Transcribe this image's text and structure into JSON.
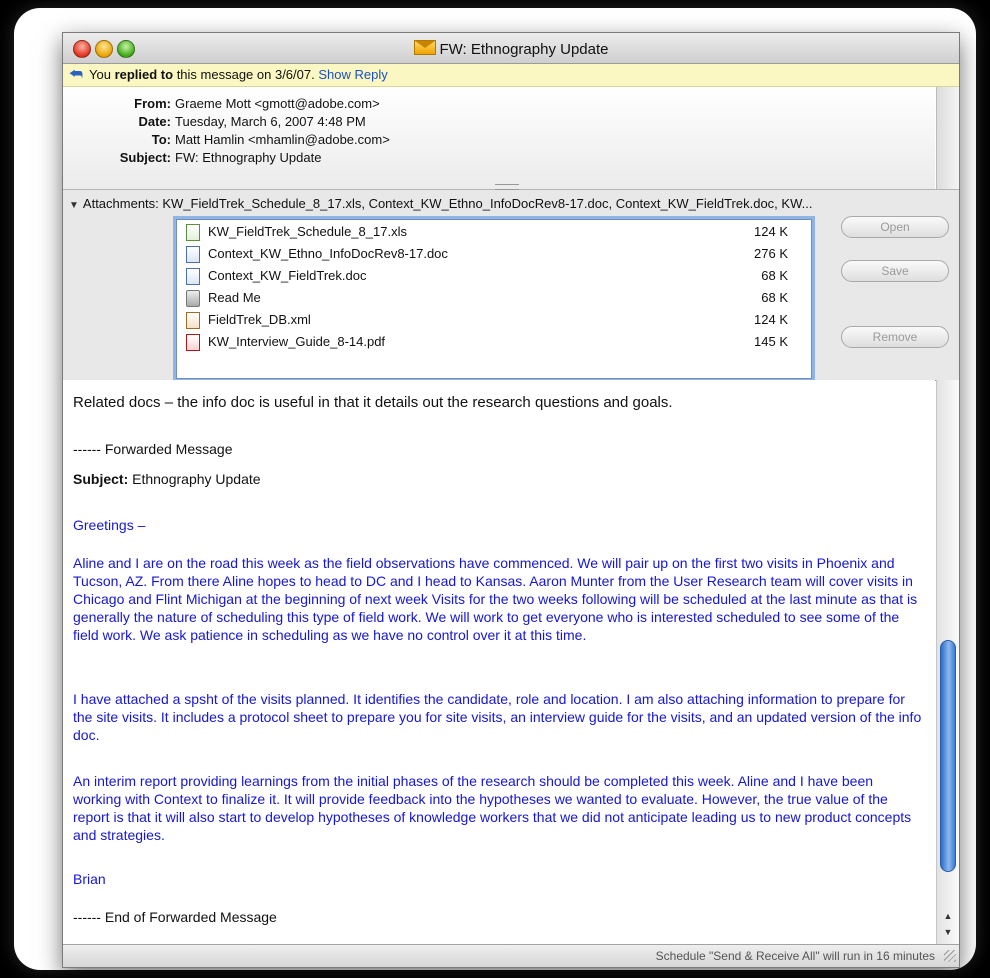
{
  "window": {
    "title": "FW: Ethnography Update"
  },
  "reply_bar": {
    "prefix": "You ",
    "bold": "replied to",
    "suffix": " this message on 3/6/07.",
    "link": "Show Reply"
  },
  "headers": [
    {
      "label": "From:",
      "value": "Graeme Mott <gmott@adobe.com>"
    },
    {
      "label": "Date:",
      "value": "Tuesday, March 6, 2007 4:48 PM"
    },
    {
      "label": "To:",
      "value": "Matt Hamlin <mhamlin@adobe.com>"
    },
    {
      "label": "Subject:",
      "value": "FW: Ethnography Update"
    }
  ],
  "attachments": {
    "summary": "Attachments:  KW_FieldTrek_Schedule_8_17.xls, Context_KW_Ethno_InfoDocRev8-17.doc, Context_KW_FieldTrek.doc, KW...",
    "files": [
      {
        "name": "KW_FieldTrek_Schedule_8_17.xls",
        "size": "124 K",
        "icon": "xls-file-icon"
      },
      {
        "name": "Context_KW_Ethno_InfoDocRev8-17.doc",
        "size": "276 K",
        "icon": "word-doc-icon"
      },
      {
        "name": "Context_KW_FieldTrek.doc",
        "size": "68 K",
        "icon": "word-doc-icon"
      },
      {
        "name": "Read Me",
        "size": "68 K",
        "icon": "readme-icon"
      },
      {
        "name": "FieldTrek_DB.xml",
        "size": "124 K",
        "icon": "xml-file-icon"
      },
      {
        "name": "KW_Interview_Guide_8-14.pdf",
        "size": "145 K",
        "icon": "pdf-file-icon"
      }
    ],
    "buttons": {
      "open": "Open",
      "save": "Save",
      "remove": "Remove"
    }
  },
  "message": {
    "intro": "Related docs – the info doc is useful in that it details out the research questions and goals.",
    "fwd_start": "------ Forwarded Message",
    "subject_label": "Subject:",
    "subject_value": " Ethnography Update",
    "greeting": "Greetings –",
    "para1": "Aline and I are on the road this week as the field observations have commenced.  We will pair up on the first two visits in Phoenix and Tucson, AZ.  From there Aline hopes to head to DC and I head to Kansas.  Aaron Munter from  the User Research team will cover visits in Chicago and Flint Michigan at the beginning of next week  Visits for the two weeks following will be scheduled at the last minute as that is generally the nature of scheduling this type of field work. We will work to get everyone who is interested scheduled to see some of the field work. We ask patience in scheduling as we have no control over it at this time.",
    "para2": "I have attached a spsht of the visits planned.  It identifies the candidate, role and location.  I am also attaching information to prepare for the site visits.  It includes a protocol sheet to prepare you for site visits, an interview guide for the visits, and an updated version of the info doc.",
    "para3": "An interim report providing learnings from the initial phases of the research should be completed this week.  Aline and I have been working with Context to finalize it.  It will provide  feedback into the hypotheses we wanted to evaluate.  However, the true value of the report is that it will also start to develop hypotheses of knowledge workers that we did not anticipate leading us to new product concepts and strategies.",
    "signature": "Brian",
    "fwd_end": "------ End of Forwarded Message"
  },
  "status": {
    "text": "Schedule \"Send & Receive All\" will run in 16 minutes"
  },
  "colors": {
    "reply_bar": "#fbf7c2",
    "forwarded_text": "#1616d6",
    "link": "#1a4fc9"
  }
}
